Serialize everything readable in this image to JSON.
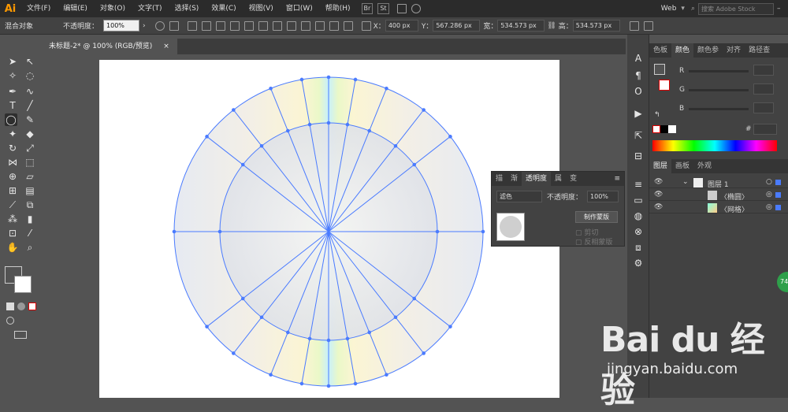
{
  "app": {
    "logo": "Ai"
  },
  "menu": [
    "文件(F)",
    "编辑(E)",
    "对象(O)",
    "文字(T)",
    "选择(S)",
    "效果(C)",
    "视图(V)",
    "窗口(W)",
    "帮助(H)"
  ],
  "title_buttons": [
    "Br",
    "St"
  ],
  "workspace": "Web",
  "search_placeholder": "搜索 Adobe Stock",
  "control": {
    "selection": "混合对象",
    "opacity_label": "不透明度：",
    "opacity_value": "100%",
    "x_label": "X：",
    "x_value": "400 px",
    "y_label": "Y：",
    "y_value": "567.286 px",
    "w_label": "宽：",
    "w_value": "534.573 px",
    "h_label": "高：",
    "h_value": "534.573 px"
  },
  "document_tab": {
    "name": "未标题-2* @ 100% (RGB/预览)",
    "close": "×"
  },
  "color_panel": {
    "tabs": [
      "色板",
      "颜色",
      "颜色参",
      "对齐",
      "路径查"
    ],
    "channels": [
      "R",
      "G",
      "B"
    ],
    "hex_label": "#"
  },
  "layers_panel": {
    "tabs": [
      "图层",
      "画板",
      "外观"
    ],
    "rows": [
      {
        "name": "图层 1"
      },
      {
        "name": "〈椭圆〉"
      },
      {
        "name": "〈网格〉"
      }
    ]
  },
  "transparency_panel": {
    "tabs": [
      "描",
      "渐",
      "透明度",
      "属",
      "变"
    ],
    "blend_mode": "滤色",
    "opacity_label": "不透明度：",
    "opacity_value": "100%",
    "make_mask_button": "制作蒙版",
    "clip_label": "剪切",
    "invert_label": "反相蒙版"
  },
  "watermark": {
    "brand": "Bai du 经验",
    "url": "jingyan.baidu.com",
    "badge": "74"
  },
  "colors": {
    "accent": "#4a7bff",
    "app_bg": "#535353",
    "panel": "#424242",
    "logo": "#ff9a00"
  }
}
